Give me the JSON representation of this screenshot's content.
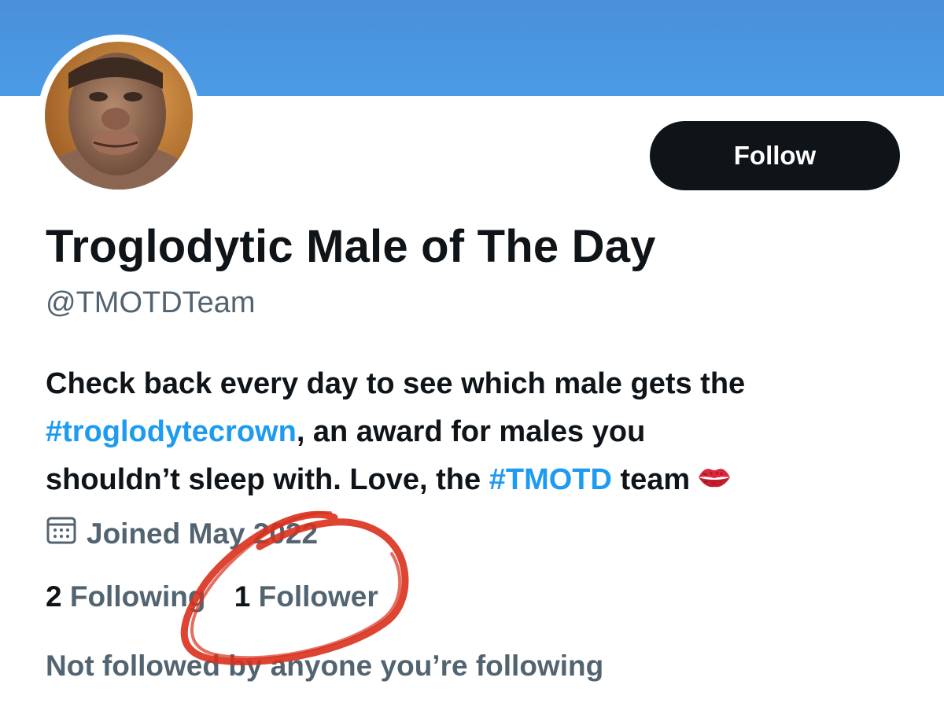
{
  "profile": {
    "display_name": "Troglodytic Male of The Day",
    "handle": "@TMOTDTeam",
    "follow_label": "Follow",
    "bio": {
      "line1": "Check back every day to see which male gets the",
      "hashtag1": "#troglodytecrown",
      "line2_rest": ", an award for males you",
      "line3_start": "shouldn’t sleep with. Love, the ",
      "hashtag2": "#TMOTD",
      "line3_end": " team",
      "emoji_icon": "kiss-lips-icon"
    },
    "joined": "Joined May 2022",
    "joined_icon": "calendar-icon",
    "following_count": "2",
    "following_label": "Following",
    "follower_count": "1",
    "follower_label": "Follower",
    "not_followed_text": "Not followed by anyone you’re following"
  },
  "colors": {
    "banner": "#4a90d9",
    "link": "#1d9bf0",
    "secondary_text": "#536471",
    "primary_text": "#0f1419",
    "annotation": "#d9301c"
  }
}
